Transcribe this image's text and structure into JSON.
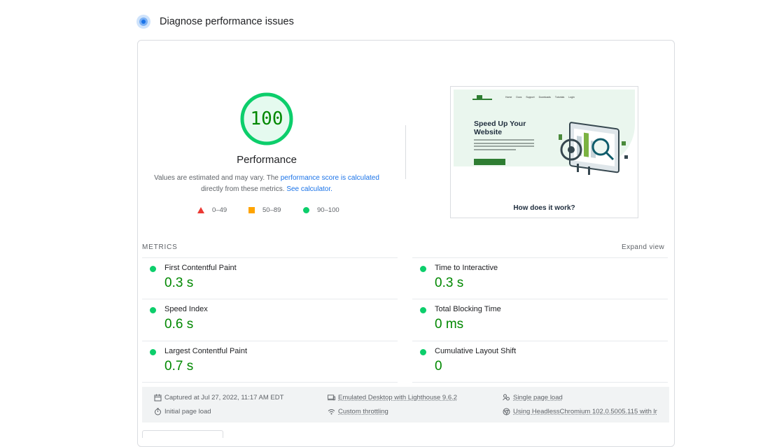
{
  "section": {
    "title": "Diagnose performance issues"
  },
  "gauge": {
    "score": "100",
    "score_fraction": 1.0,
    "title": "Performance",
    "color": "#0cce6b",
    "text_color": "#008800"
  },
  "description": {
    "prefix": "Values are estimated and may vary. The ",
    "link1": "performance score is calculated",
    "middle": " directly from these metrics. ",
    "link2": "See calculator."
  },
  "legend": [
    {
      "shape": "triangle",
      "label": "0–49",
      "color": "#eb3a34"
    },
    {
      "shape": "square",
      "label": "50–89",
      "color": "#ffa400"
    },
    {
      "shape": "circle",
      "label": "90–100",
      "color": "#0cce6b"
    }
  ],
  "screenshot": {
    "hero_title": "Speed Up Your Website",
    "nav": [
      "Home",
      "Docs",
      "Support",
      "Downloads",
      "Tutorials",
      "Login"
    ],
    "how_heading": "How does it work?"
  },
  "metrics": {
    "label": "METRICS",
    "expand": "Expand view",
    "items": [
      {
        "title": "First Contentful Paint",
        "value": "0.3 s"
      },
      {
        "title": "Time to Interactive",
        "value": "0.3 s"
      },
      {
        "title": "Speed Index",
        "value": "0.6 s"
      },
      {
        "title": "Total Blocking Time",
        "value": "0 ms"
      },
      {
        "title": "Largest Contentful Paint",
        "value": "0.7 s"
      },
      {
        "title": "Cumulative Layout Shift",
        "value": "0"
      }
    ]
  },
  "footer": {
    "captured": "Captured at Jul 27, 2022, 11:17 AM EDT",
    "emulated": "Emulated Desktop with Lighthouse 9.6.2",
    "single": "Single page load",
    "initial": "Initial page load",
    "throttling": "Custom throttling",
    "browser": "Using HeadlessChromium 102.0.5005.115 with lr"
  }
}
